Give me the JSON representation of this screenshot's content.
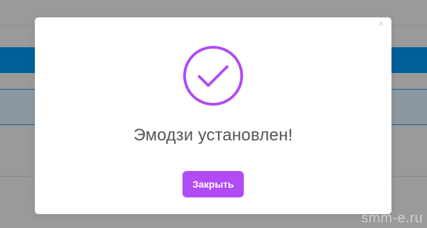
{
  "dialog": {
    "close_glyph": "×",
    "title": "Эмодзи установлен!",
    "close_button_label": "Закрыть",
    "icon": "checkmark-circle-icon"
  },
  "watermark": "smm-e.ru",
  "colors": {
    "accent": "#b04bf6",
    "title_text": "#545454",
    "background_overlay": "#9a9a9a",
    "background_blue_band": "#005f9a"
  }
}
